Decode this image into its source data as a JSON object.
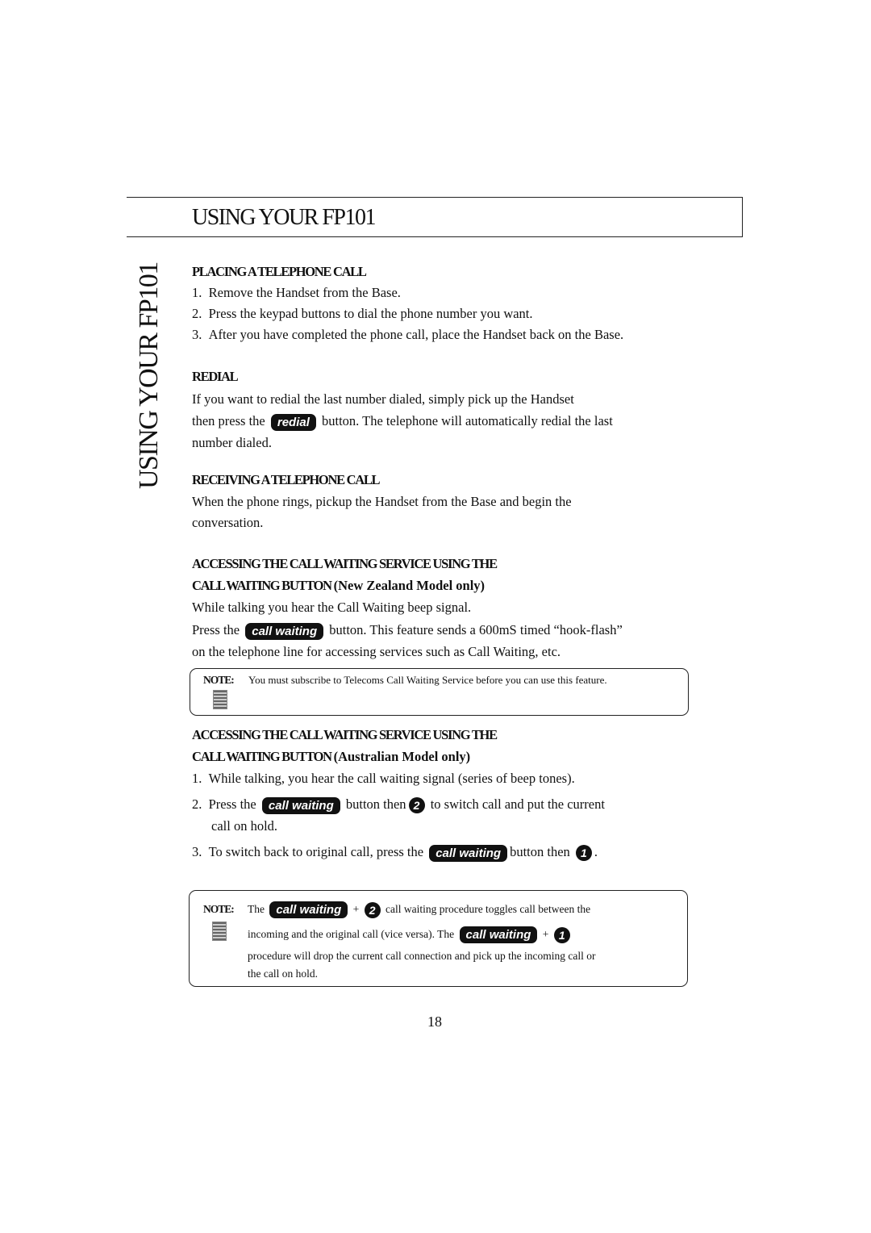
{
  "header": {
    "title": "USING YOUR FP101",
    "side_tab": "USING YOUR FP101"
  },
  "placing": {
    "heading": "PLACING A TELEPHONE CALL",
    "steps": [
      {
        "n": "1.",
        "text": "Remove the Handset from the Base."
      },
      {
        "n": "2.",
        "text": "Press the keypad buttons to dial the phone number you want."
      },
      {
        "n": "3.",
        "text": "After you have completed the phone call, place the Handset back on the Base."
      }
    ]
  },
  "redial": {
    "heading": "REDIAL",
    "line1": "If you want to redial the last number dialed, simply pick up the Handset",
    "line2a": "then press the",
    "button": "redial",
    "line2b": "button. The telephone will automatically redial the last",
    "line3": "number dialed."
  },
  "receiving": {
    "heading": "RECEIVING A TELEPHONE CALL",
    "line1": "When the phone rings, pickup the Handset from the Base and begin the",
    "line2": "conversation."
  },
  "nz": {
    "heading1": "ACCESSING THE CALL WAITING SERVICE USING THE",
    "heading2": "CALL WAITING BUTTON",
    "heading2b": "(New Zealand Model only)",
    "line1": "While talking you hear the Call Waiting beep signal.",
    "line2a": "Press the",
    "button": "call waiting",
    "line2b": "button.  This feature sends a 600mS timed “hook-flash”",
    "line3": "on the telephone line for accessing services such as Call Waiting, etc.",
    "note_label": "NOTE:",
    "note_text": "You must subscribe to Telecoms Call Waiting Service before you can use this feature."
  },
  "au": {
    "heading1": "ACCESSING THE CALL WAITING SERVICE USING THE",
    "heading2": "CALL WAITING BUTTON",
    "heading2b": "(Australian Model only)",
    "s1n": "1.",
    "s1": "While talking, you hear the call waiting signal (series of beep tones).",
    "s2n": "2.",
    "s2a": "Press the",
    "button": "call waiting",
    "s2b": "button then",
    "key2": "2",
    "s2c": "to switch call and put the current",
    "s2d": "call on hold.",
    "s3n": "3.",
    "s3a": "To switch back to original call, press the",
    "s3b": "button then",
    "key1": "1",
    "s3c": ".",
    "note_label": "NOTE:",
    "n1a": "The",
    "plus": "+",
    "n1b": "call waiting procedure toggles call between the",
    "n2a": "incoming and the original call (vice versa).  The",
    "n3": "procedure will drop the current call connection and pick up the incoming call or",
    "n4": "the call on hold."
  },
  "page_number": "18",
  "icons": {
    "note": "note-document-icon"
  }
}
